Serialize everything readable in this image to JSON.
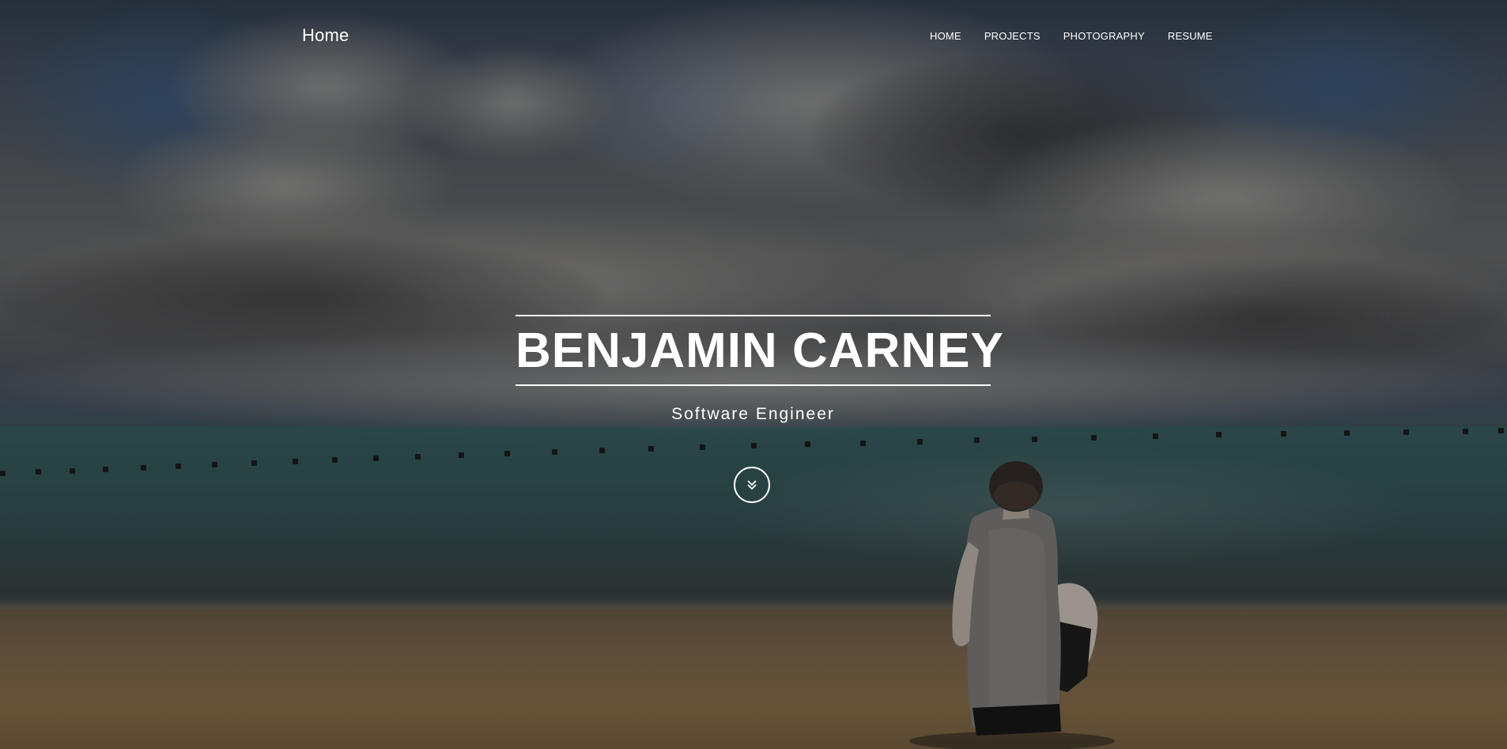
{
  "nav": {
    "brand": "Home",
    "items": [
      {
        "label": "HOME"
      },
      {
        "label": "PROJECTS"
      },
      {
        "label": "PHOTOGRAPHY"
      },
      {
        "label": "RESUME"
      }
    ]
  },
  "hero": {
    "name": "BENJAMIN CARNEY",
    "subtitle": "Software Engineer",
    "scroll_icon": "chevron-double-down-icon"
  },
  "colors": {
    "text": "#ffffff",
    "sky": "#3a4452",
    "sea": "#2f5355",
    "sand": "#6e5a43"
  }
}
